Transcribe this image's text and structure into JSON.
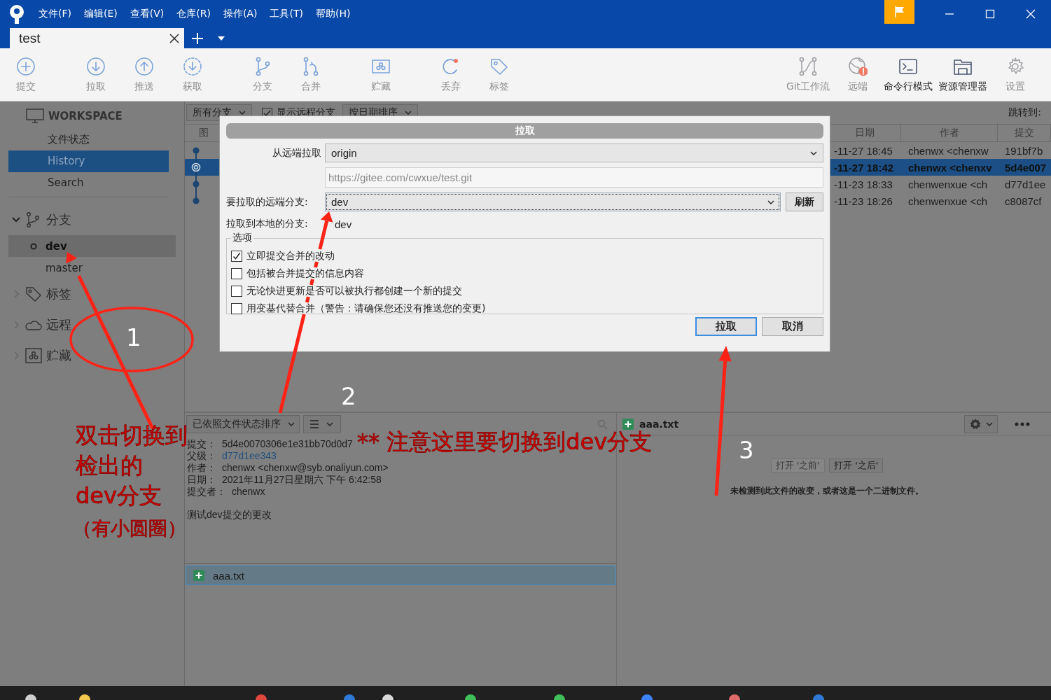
{
  "header": {
    "menu": [
      "文件(F)",
      "编辑(E)",
      "查看(V)",
      "仓库(R)",
      "操作(A)",
      "工具(T)",
      "帮助(H)"
    ],
    "tabs": [
      {
        "label": "test",
        "selected": true
      }
    ]
  },
  "toolbar": {
    "left": [
      {
        "label": "提交",
        "kind": "commit",
        "disabled": true
      },
      {
        "label": "拉取",
        "kind": "pull",
        "disabled": true
      },
      {
        "label": "推送",
        "kind": "push",
        "disabled": true
      },
      {
        "label": "获取",
        "kind": "fetch",
        "disabled": true
      },
      {
        "label": "分支",
        "kind": "branch",
        "disabled": true
      },
      {
        "label": "合并",
        "kind": "merge",
        "disabled": true
      },
      {
        "label": "贮藏",
        "kind": "stash",
        "disabled": true
      },
      {
        "label": "丢弃",
        "kind": "discard",
        "disabled": true
      },
      {
        "label": "标签",
        "kind": "tag",
        "disabled": true
      }
    ],
    "right": [
      {
        "label": "Git工作流",
        "kind": "flow",
        "disabled": true
      },
      {
        "label": "远端",
        "kind": "remote",
        "disabled": true
      },
      {
        "label": "命令行模式",
        "kind": "terminal",
        "disabled": false
      },
      {
        "label": "资源管理器",
        "kind": "explorer",
        "disabled": false
      },
      {
        "label": "设置",
        "kind": "settings",
        "disabled": true
      }
    ]
  },
  "sidebar": {
    "workspace_title": "WORKSPACE",
    "workspace_items": [
      {
        "label": "文件状态",
        "selected": false
      },
      {
        "label": "History",
        "selected": true
      },
      {
        "label": "Search",
        "selected": false
      }
    ],
    "sections": [
      {
        "label": "分支",
        "kind": "branches",
        "expanded": true,
        "children": [
          {
            "label": "dev",
            "current": true,
            "selected": true
          },
          {
            "label": "master",
            "current": false,
            "selected": false
          }
        ]
      },
      {
        "label": "标签",
        "kind": "tags",
        "expanded": false
      },
      {
        "label": "远程",
        "kind": "remotes",
        "expanded": false
      },
      {
        "label": "贮藏",
        "kind": "stashes",
        "expanded": false
      }
    ]
  },
  "history": {
    "branch_filter": "所有分支",
    "show_remote": {
      "label": "显示远程分支",
      "checked": true
    },
    "sort": "按日期排序",
    "jump_label": "跳转到:",
    "columns": [
      "图",
      "日期",
      "作者",
      "提交"
    ],
    "rows": [
      {
        "date": "-11-27 18:45",
        "author": "chenwx <chenxw",
        "commit": "191bf7b",
        "selected": false
      },
      {
        "date": "-11-27 18:42",
        "author": "chenwx <chenxv",
        "commit": "5d4e007",
        "selected": true
      },
      {
        "date": "-11-23 18:33",
        "author": "chenwenxue <ch",
        "commit": "d77d1ee",
        "selected": false
      },
      {
        "date": "-11-23 18:26",
        "author": "chenwenxue <ch",
        "commit": "c8087cf",
        "selected": false
      }
    ]
  },
  "pull_dialog": {
    "title": "拉取",
    "remote_label": "从远端拉取",
    "remote": "origin",
    "url": "https://gitee.com/cwxue/test.git",
    "remote_branch_label": "要拉取的远端分支:",
    "remote_branch": "dev",
    "refresh": "刷新",
    "local_branch_label": "拉取到本地的分支:",
    "local_branch": "dev",
    "options_title": "选项",
    "options": [
      {
        "label": "立即提交合并的改动",
        "checked": true
      },
      {
        "label": "包括被合并提交的信息内容",
        "checked": false
      },
      {
        "label": "无论快进更新是否可以被执行都创建一个新的提交",
        "checked": false
      },
      {
        "label": "用变基代替合并（警告：请确保您还没有推送您的变更)",
        "checked": false
      }
    ],
    "buttons": [
      {
        "label": "拉取",
        "default": true
      },
      {
        "label": "取消",
        "default": false
      }
    ]
  },
  "details": {
    "sort": "已依照文件状态排序",
    "fields": [
      {
        "label": "提交：",
        "value": "5d4e0070306e1e31bb70d0d7",
        "kind": "text"
      },
      {
        "label": "父级：",
        "value": "d77d1ee343",
        "kind": "link"
      },
      {
        "label": "作者：",
        "value": "chenwx <chenxw@syb.onaliyun.com>",
        "kind": "text"
      },
      {
        "label": "日期：",
        "value": "2021年11月27日星期六 下午 6:42:58",
        "kind": "text"
      },
      {
        "label": "提交者：",
        "value": "chenwx",
        "kind": "text"
      }
    ],
    "message": "测试dev提交的更改",
    "files": [
      {
        "name": "aaa.txt",
        "selected": true
      }
    ]
  },
  "diff": {
    "file": "aaa.txt",
    "buttons": [
      {
        "label": "打开 '之前'",
        "disabled": true
      },
      {
        "label": "打开 '之后'",
        "disabled": false
      }
    ],
    "message": "未检测到此文件的改变，或者这是一个二进制文件。"
  },
  "annotations": [
    {
      "kind": "number",
      "text": "1"
    },
    {
      "kind": "number",
      "text": "2"
    },
    {
      "kind": "number",
      "text": "3"
    },
    {
      "kind": "note",
      "text": "双击切换到"
    },
    {
      "kind": "note",
      "text": "检出的"
    },
    {
      "kind": "note",
      "text": "dev分支"
    },
    {
      "kind": "note",
      "text": "（有小圆圈）"
    },
    {
      "kind": "note",
      "text": "** 注意这里要切换到dev分支"
    }
  ]
}
